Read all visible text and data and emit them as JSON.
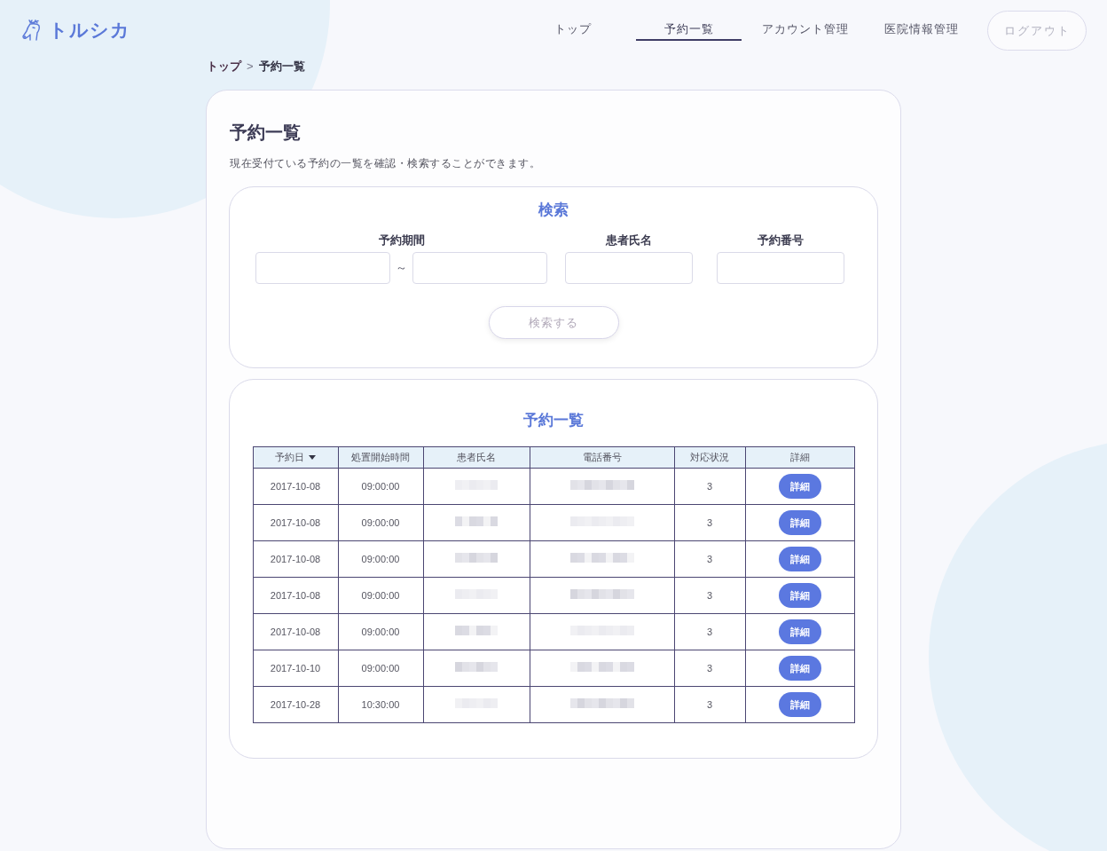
{
  "logo": {
    "text": "トルシカ"
  },
  "nav": [
    {
      "label": "トップ",
      "selected": false
    },
    {
      "label": "予約一覧",
      "selected": true
    },
    {
      "label": "アカウント管理",
      "selected": false
    },
    {
      "label": "医院情報管理",
      "selected": false
    }
  ],
  "logout_button": "ログアウト",
  "breadcrumb": {
    "items": [
      "トップ",
      "予約一覧"
    ],
    "separator": ">"
  },
  "page": {
    "title": "予約一覧",
    "description": "現在受付ている予約の一覧を確認・検索することができます。"
  },
  "search": {
    "title": "検索",
    "fields": [
      {
        "kind": "range",
        "label": "予約期間",
        "separator": "～"
      },
      {
        "kind": "text",
        "label": "患者氏名"
      },
      {
        "kind": "text",
        "label": "予約番号"
      }
    ],
    "button": "検索する"
  },
  "list": {
    "title": "予約一覧",
    "columns": [
      {
        "label": "予約日",
        "sorted": true
      },
      {
        "label": "処置開始時間",
        "sorted": false
      },
      {
        "label": "患者氏名",
        "sorted": false
      },
      {
        "label": "電話番号",
        "sorted": false
      },
      {
        "label": "対応状況",
        "sorted": false
      },
      {
        "label": "詳細",
        "sorted": false
      }
    ],
    "rows": [
      {
        "date": "2017-10-08",
        "start_time": "09:00:00",
        "status": "3",
        "detail_button": "詳細"
      },
      {
        "date": "2017-10-08",
        "start_time": "09:00:00",
        "status": "3",
        "detail_button": "詳細"
      },
      {
        "date": "2017-10-08",
        "start_time": "09:00:00",
        "status": "3",
        "detail_button": "詳細"
      },
      {
        "date": "2017-10-08",
        "start_time": "09:00:00",
        "status": "3",
        "detail_button": "詳細"
      },
      {
        "date": "2017-10-08",
        "start_time": "09:00:00",
        "status": "3",
        "detail_button": "詳細"
      },
      {
        "date": "2017-10-10",
        "start_time": "09:00:00",
        "status": "3",
        "detail_button": "詳細"
      },
      {
        "date": "2017-10-28",
        "start_time": "10:30:00",
        "status": "3",
        "detail_button": "詳細"
      }
    ]
  }
}
